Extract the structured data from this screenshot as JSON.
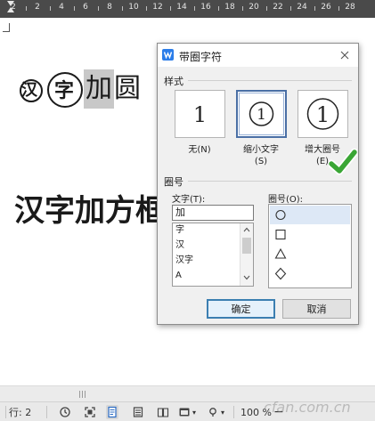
{
  "ruler": {
    "labels": [
      "2",
      "2",
      "4",
      "6",
      "8",
      "10",
      "12",
      "14",
      "16",
      "18",
      "20",
      "22",
      "24",
      "26",
      "28"
    ]
  },
  "document": {
    "line1": {
      "small_enclosed_char": "汉",
      "large_enclosed_char": "字",
      "selected_char": "加",
      "trailing_text": "圆"
    },
    "line2": {
      "text": "汉字加方框"
    }
  },
  "dialog": {
    "title": "带圈字符",
    "style_section_label": "样式",
    "style_options": [
      {
        "glyph": "1",
        "caption": "无(N)"
      },
      {
        "glyph": "①",
        "caption": "缩小文字\n(S)"
      },
      {
        "glyph": "①",
        "caption": "增大圈号\n(E)"
      }
    ],
    "selected_style_index": 1,
    "enclosure_section_label": "圈号",
    "text_label": "文字(T):",
    "text_value": "加",
    "char_list": [
      "字",
      "汉",
      "汉字",
      "A"
    ],
    "enclosure_label": "圈号(O):",
    "enclosure_list": [
      "○",
      "□",
      "△",
      "◇"
    ],
    "selected_enclosure_index": 0,
    "ok_label": "确定",
    "cancel_label": "取消"
  },
  "status_bar": {
    "line_text": "行: 2",
    "zoom": "100 %",
    "zoom_out_symbol": "−"
  },
  "watermark": "cfan.com.cn",
  "colors": {
    "ruler_bg": "#4a4a4a",
    "dialog_bg": "#f0f0f0",
    "selection": "#c8c8c8",
    "checkmark": "#3aa635",
    "app_icon": "#2b7de9",
    "primary_button_border": "#3c7fb1"
  },
  "icons": [
    "dialog-app-icon",
    "close-icon",
    "checkmark-icon",
    "history-icon",
    "fullscreen-icon",
    "page-view-icon",
    "outline-view-icon",
    "reading-view-icon",
    "web-view-icon",
    "eye-icon",
    "zoom-out-icon"
  ]
}
